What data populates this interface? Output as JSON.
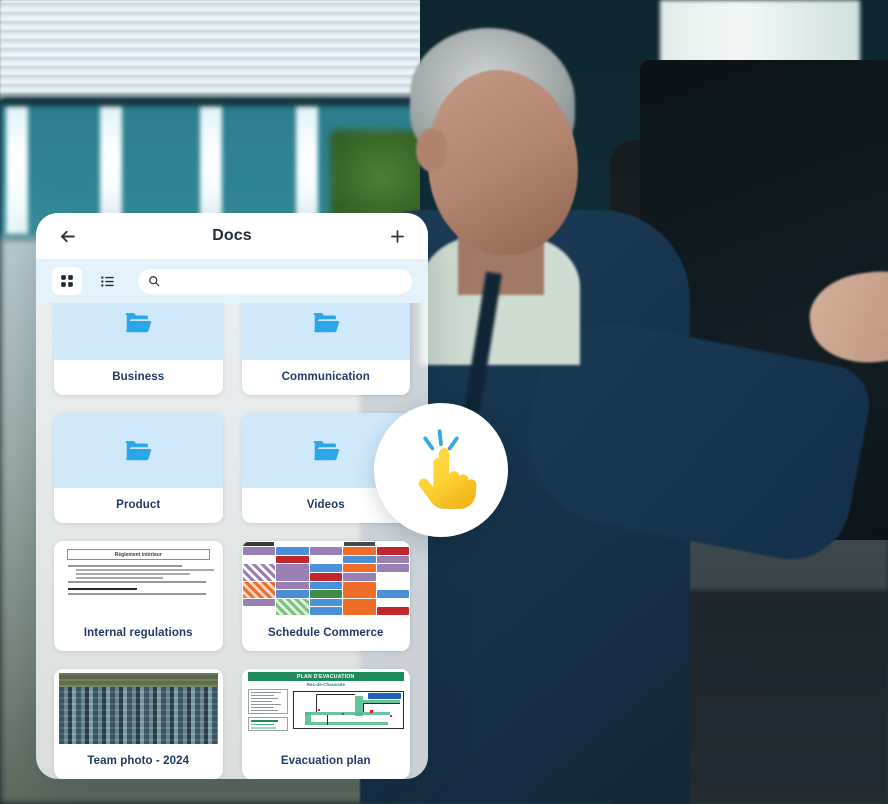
{
  "app": {
    "header": {
      "title": "Docs",
      "back_icon": "arrow-left-icon",
      "add_icon": "plus-icon"
    },
    "toolbar": {
      "grid_view_icon": "grid-view-icon",
      "list_view_icon": "list-view-icon",
      "active_view": "grid",
      "search": {
        "icon": "search-icon",
        "value": "",
        "placeholder": ""
      }
    },
    "items": [
      {
        "label": "Business",
        "type": "folder",
        "thumb": "folder-icon"
      },
      {
        "label": "Communication",
        "type": "folder",
        "thumb": "folder-icon"
      },
      {
        "label": "Product",
        "type": "folder",
        "thumb": "folder-icon"
      },
      {
        "label": "Videos",
        "type": "folder",
        "thumb": "folder-icon"
      },
      {
        "label": "Internal regulations",
        "type": "document",
        "thumb": "document-preview"
      },
      {
        "label": "Schedule Commerce",
        "type": "document",
        "thumb": "schedule-preview"
      },
      {
        "label": "Team photo - 2024",
        "type": "image",
        "thumb": "photo-preview"
      },
      {
        "label": "Evacuation plan",
        "type": "document",
        "thumb": "floorplan-preview"
      }
    ],
    "thumbnails": {
      "internal_regulations": {
        "title": "Règlement intérieur",
        "intro": "Le présent Règlement intérieur a pour objet de définir :",
        "section": "ARTICLE 1 - DISCIPLINE GENERALE"
      },
      "evacuation_plan": {
        "title": "PLAN D'EVACUATION",
        "subtitle": "Rez-de-Chaussée"
      }
    },
    "overlay": {
      "tap_icon": "tap-hand-icon"
    }
  },
  "colors": {
    "panel_bg": "#f7f9fa",
    "toolbar_bg": "#e4f2fb",
    "folder_thumb_bg": "#cfe9fb",
    "folder_icon": "#2ba6e8",
    "label_text": "#1e3a6b",
    "tap_hand": "#ffd233",
    "tap_spark": "#38a8e0",
    "evac_green": "#1f8a5c"
  }
}
